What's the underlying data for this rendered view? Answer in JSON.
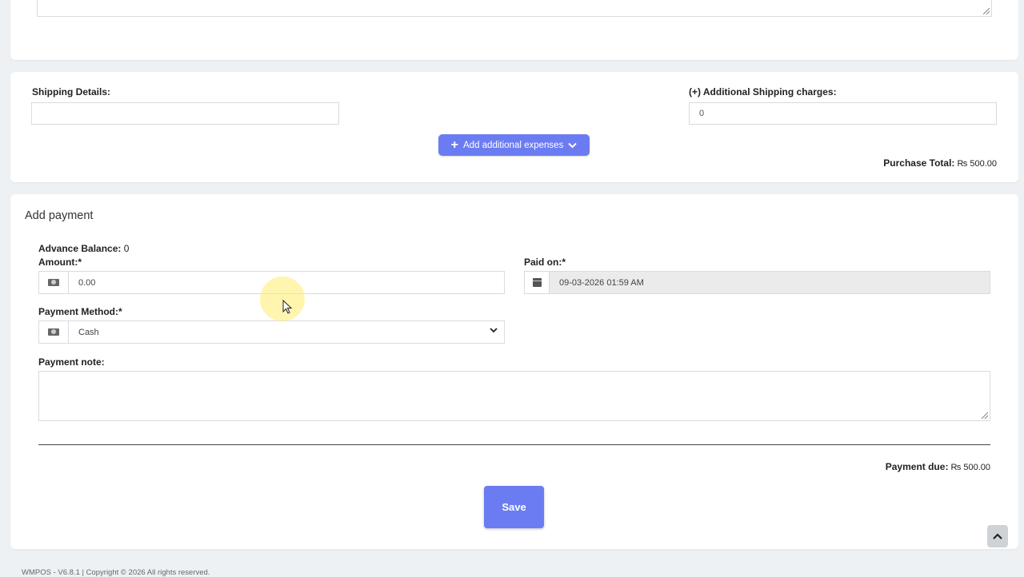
{
  "shipping": {
    "details_label": "Shipping Details:",
    "details_value": "",
    "additional_charges_label": "(+) Additional Shipping charges:",
    "additional_charges_value": "0",
    "add_expenses_button": "Add additional expenses",
    "purchase_total_label": "Purchase Total:",
    "purchase_total_value": " ₨ 500.00"
  },
  "payment": {
    "title": "Add payment",
    "advance_balance_label": "Advance Balance:",
    "advance_balance_value": " 0",
    "amount_label": "Amount:*",
    "amount_value": "0.00",
    "paid_on_label": "Paid on:*",
    "paid_on_value": "09-03-2026 01:59 AM",
    "method_label": "Payment Method:*",
    "method_value": "Cash",
    "note_label": "Payment note:",
    "note_value": "",
    "due_label": "Payment due:",
    "due_value": " ₨ 500.00",
    "save_button": "Save"
  },
  "icons": {
    "amount_addon": "money-icon",
    "method_addon": "money-icon",
    "paid_on_addon": "calendar-icon",
    "scroll_top": "chevron-up-icon"
  },
  "colors": {
    "primary_button": "#6b7cf2",
    "background": "#eef1f4"
  },
  "footer": {
    "text": "WMPOS - V6.8.1 | Copyright © 2026 All rights reserved."
  }
}
